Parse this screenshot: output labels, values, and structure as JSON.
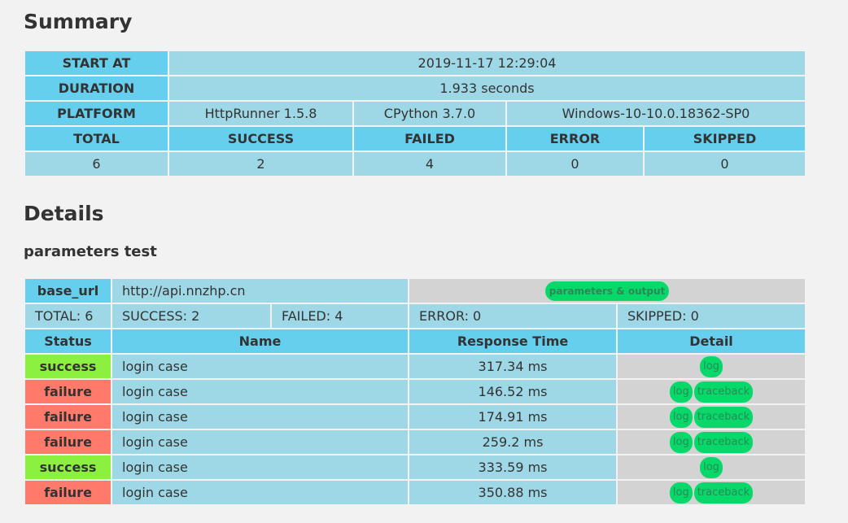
{
  "summary": {
    "heading": "Summary",
    "start_at": {
      "label": "START AT",
      "value": "2019-11-17 12:29:04"
    },
    "duration": {
      "label": "DURATION",
      "value": "1.933 seconds"
    },
    "platform": {
      "label": "PLATFORM",
      "httprunner": "HttpRunner 1.5.8",
      "python": "CPython 3.7.0",
      "os": "Windows-10-10.0.18362-SP0"
    },
    "stat_headers": [
      "TOTAL",
      "SUCCESS",
      "FAILED",
      "ERROR",
      "SKIPPED"
    ],
    "stat_values": [
      "6",
      "2",
      "4",
      "0",
      "0"
    ]
  },
  "details": {
    "heading": "Details",
    "suite_title": "parameters test",
    "base_url_label": "base_url",
    "base_url": "http://api.nnzhp.cn",
    "params_button": "parameters & output",
    "totals": {
      "total": "TOTAL: 6",
      "success": "SUCCESS: 2",
      "failed": "FAILED: 4",
      "error": "ERROR: 0",
      "skipped": "SKIPPED: 0"
    },
    "columns": [
      "Status",
      "Name",
      "Response Time",
      "Detail"
    ],
    "log_label": "log",
    "traceback_label": "traceback",
    "rows": [
      {
        "status": "success",
        "name": "login case",
        "time": "317.34 ms"
      },
      {
        "status": "failure",
        "name": "login case",
        "time": "146.52 ms"
      },
      {
        "status": "failure",
        "name": "login case",
        "time": "174.91 ms"
      },
      {
        "status": "failure",
        "name": "login case",
        "time": "259.2 ms"
      },
      {
        "status": "success",
        "name": "login case",
        "time": "333.59 ms"
      },
      {
        "status": "failure",
        "name": "login case",
        "time": "350.88 ms"
      }
    ]
  },
  "colors": {
    "header_blue": "#66cfed",
    "value_blue": "#9ed8e6",
    "success_green": "#8cf041",
    "failure_red": "#ff7a6b",
    "button_green": "#06d86a",
    "detail_gray": "#d3d3d3"
  }
}
